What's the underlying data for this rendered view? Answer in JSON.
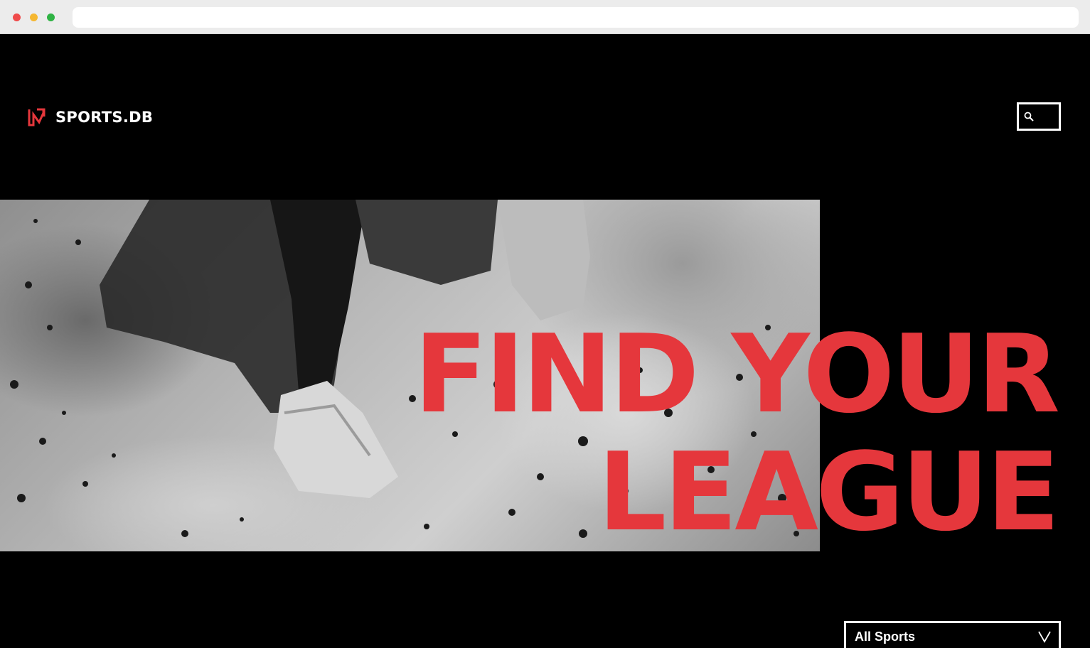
{
  "brand": {
    "name": "SPORTS.DB",
    "accent": "#e5373c"
  },
  "header": {
    "search_icon": "search-icon"
  },
  "hero": {
    "headline_line1": "FIND YOUR",
    "headline_line2": "LEAGUE"
  },
  "filter": {
    "selected": "All Sports",
    "icon": "chevron-down-icon"
  }
}
